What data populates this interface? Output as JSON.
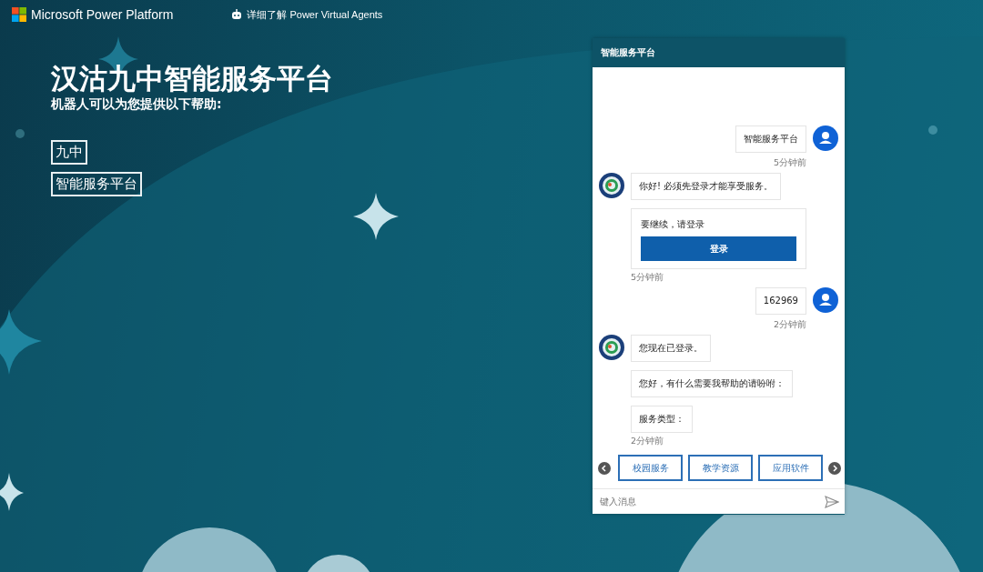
{
  "topbar": {
    "brand": "Microsoft Power Platform",
    "link": "详细了解 Power Virtual Agents"
  },
  "hero": {
    "title": "汉沽九中智能服务平台",
    "subtitle": "机器人可以为您提供以下帮助:",
    "topics": [
      "九中",
      "智能服务平台"
    ]
  },
  "chat": {
    "title": "智能服务平台",
    "groups": [
      {
        "kind": "user",
        "messages": [
          {
            "kind": "text",
            "text": "智能服务平台"
          }
        ],
        "time": "5分钟前"
      },
      {
        "kind": "bot",
        "messages": [
          {
            "kind": "text",
            "text": "你好! 必须先登录才能享受服务。"
          },
          {
            "kind": "card",
            "text": "要继续，请登录",
            "button": "登录"
          }
        ],
        "time": "5分钟前"
      },
      {
        "kind": "user",
        "messages": [
          {
            "kind": "text",
            "text": "162969"
          }
        ],
        "time": "2分钟前"
      },
      {
        "kind": "bot",
        "messages": [
          {
            "kind": "text",
            "text": "您现在已登录。"
          },
          {
            "kind": "text",
            "text": "您好，有什么需要我帮助的请吩咐："
          },
          {
            "kind": "text",
            "text": "服务类型："
          }
        ],
        "time": "2分钟前"
      }
    ],
    "suggested_actions": [
      "校园服务",
      "教学资源",
      "应用软件"
    ],
    "input": {
      "placeholder": "键入消息"
    }
  }
}
